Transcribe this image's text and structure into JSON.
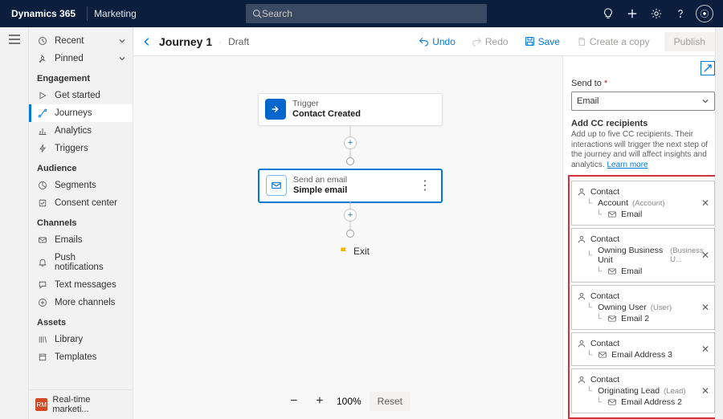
{
  "appbar": {
    "brand": "Dynamics 365",
    "module": "Marketing",
    "search_placeholder": "Search"
  },
  "nav": {
    "recent": "Recent",
    "pinned": "Pinned",
    "groups": {
      "engagement": "Engagement",
      "audience": "Audience",
      "channels": "Channels",
      "assets": "Assets"
    },
    "items": {
      "get_started": "Get started",
      "journeys": "Journeys",
      "analytics": "Analytics",
      "triggers": "Triggers",
      "segments": "Segments",
      "consent": "Consent center",
      "emails": "Emails",
      "push": "Push notifications",
      "text": "Text messages",
      "more_channels": "More channels",
      "library": "Library",
      "templates": "Templates"
    },
    "bottom_badge": "RM",
    "bottom_label": "Real-time marketi..."
  },
  "toolbar": {
    "title": "Journey 1",
    "status": "Draft",
    "undo": "Undo",
    "redo": "Redo",
    "save": "Save",
    "copy": "Create a copy",
    "publish": "Publish"
  },
  "flow": {
    "trigger_label": "Trigger",
    "trigger_name": "Contact Created",
    "email_label": "Send an email",
    "email_name": "Simple email",
    "exit": "Exit"
  },
  "zoom": {
    "level": "100%",
    "reset": "Reset"
  },
  "panel": {
    "send_to_label": "Send to",
    "send_to_value": "Email",
    "cc_title": "Add CC recipients",
    "cc_hint_pre": "Add up to five CC recipients. Their interactions will trigger the next step of the journey and will affect insights and analytics. ",
    "cc_hint_link": "Learn more",
    "cards": [
      {
        "root": "Contact",
        "mid": "Account",
        "mid_meta": "(Account)",
        "leaf": "Email"
      },
      {
        "root": "Contact",
        "mid": "Owning Business Unit",
        "mid_meta": "(Business U...",
        "leaf": "Email"
      },
      {
        "root": "Contact",
        "mid": "Owning User",
        "mid_meta": "(User)",
        "leaf": "Email 2"
      },
      {
        "root": "Contact",
        "mid": "",
        "mid_meta": "",
        "leaf": "Email Address 3"
      },
      {
        "root": "Contact",
        "mid": "Originating Lead",
        "mid_meta": "(Lead)",
        "leaf": "Email Address 2"
      }
    ]
  }
}
